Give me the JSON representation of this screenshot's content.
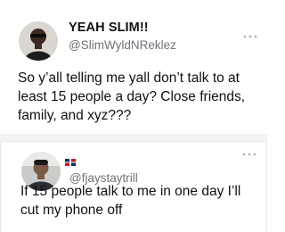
{
  "tweet1": {
    "display_name": "YEAH SLIM!!",
    "handle": "@SlimWyldNReklez",
    "text": "So y’all telling me yall don’t talk to at least 15 people a day? Close friends, family, and xyz???",
    "more_icon": "more-dots-icon"
  },
  "tweet2": {
    "handle": "@fjaystaytrill",
    "flag_icon": "dominican-flag-icon",
    "text": "If 15 people talk to me in one day I’ll cut my phone off",
    "more_icon": "more-dots-icon"
  },
  "colors": {
    "text": "#111111",
    "handle": "#6e7378",
    "divider": "#f2f3f5",
    "border": "#e7e8ea"
  }
}
